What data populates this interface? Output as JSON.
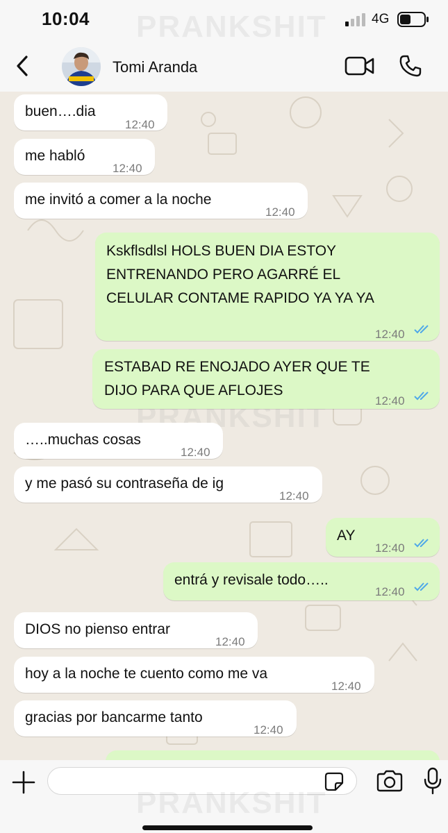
{
  "status_bar": {
    "time": "10:04",
    "network": "4G"
  },
  "header": {
    "contact_name": "Tomi Aranda"
  },
  "watermark": "PRANKSHIT",
  "messages": [
    {
      "dir": "in",
      "text": "buen….dia",
      "time": "12:40"
    },
    {
      "dir": "in",
      "text": "me habló",
      "time": "12:40"
    },
    {
      "dir": "in",
      "text": "me invitó a comer a la noche",
      "time": "12:40"
    },
    {
      "dir": "out",
      "lines": [
        "Kskflsdlsl HOLS BUEN DIA ESTOY",
        "ENTRENANDO PERO AGARRÉ EL",
        "CELULAR CONTAME RAPIDO YA YA YA"
      ],
      "time": "12:40",
      "read": true
    },
    {
      "dir": "out",
      "lines": [
        "ESTABAD RE ENOJADO AYER QUE TE",
        "DIJO PARA QUE AFLOJES"
      ],
      "time": "12:40",
      "read": true
    },
    {
      "dir": "in",
      "text": "…..muchas cosas",
      "time": "12:40"
    },
    {
      "dir": "in",
      "text": "y me pasó su contraseña de ig",
      "time": "12:40"
    },
    {
      "dir": "out",
      "text": "AY",
      "time": "12:40",
      "read": true
    },
    {
      "dir": "out",
      "text": "entrá y revisale todo…..",
      "time": "12:40",
      "read": true
    },
    {
      "dir": "in",
      "text": "DIOS no pienso entrar",
      "time": "12:40"
    },
    {
      "dir": "in",
      "text": "hoy a la noche te cuento como me va",
      "time": "12:40"
    },
    {
      "dir": "in",
      "text": "gracias por bancarme tanto",
      "time": "12:40"
    }
  ],
  "input": {
    "placeholder": ""
  },
  "colors": {
    "incoming": "#ffffff",
    "outgoing": "#dcf8c6",
    "chat_bg": "#efeae2",
    "read_tick": "#4fa8e8"
  }
}
